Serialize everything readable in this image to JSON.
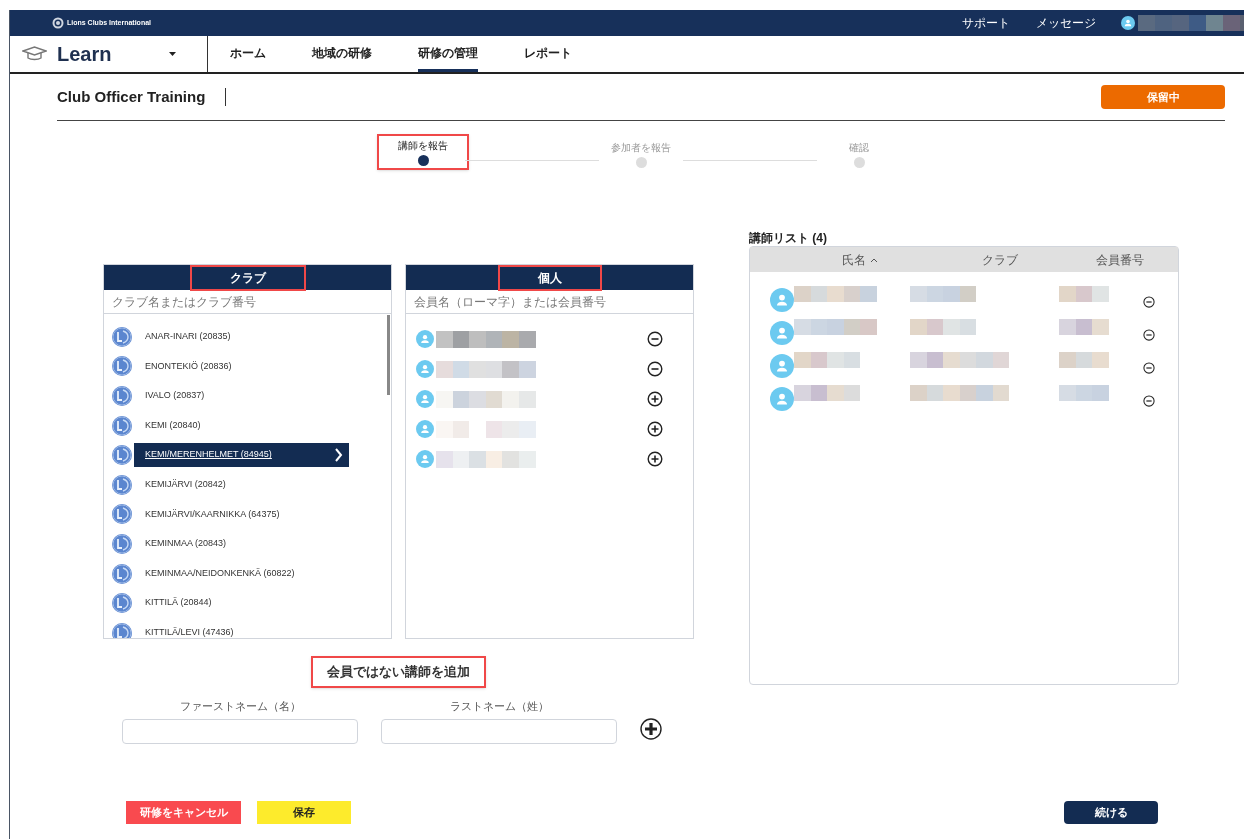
{
  "top_bar": {
    "brand": "Lions Clubs International",
    "links": [
      "サポート",
      "メッセージ"
    ]
  },
  "nav": {
    "app": "Learn",
    "tabs": [
      {
        "label": "ホーム",
        "selected": false
      },
      {
        "label": "地域の研修",
        "selected": false
      },
      {
        "label": "研修の管理",
        "selected": true
      },
      {
        "label": "レポート",
        "selected": false
      }
    ]
  },
  "page": {
    "title": "Club Officer Training",
    "status_button": "保留中"
  },
  "steps": [
    {
      "label": "講師を報告",
      "active": true,
      "highlighted": true
    },
    {
      "label": "参加者を報告",
      "active": false,
      "highlighted": false
    },
    {
      "label": "確認",
      "active": false,
      "highlighted": false
    }
  ],
  "clubs_panel": {
    "title": "クラブ",
    "highlighted": true,
    "placeholder": "クラブ名またはクラブ番号",
    "items": [
      {
        "label": "ANAR-INARI (20835)",
        "selected": false
      },
      {
        "label": "ENONTEKIÖ (20836)",
        "selected": false
      },
      {
        "label": "IVALO (20837)",
        "selected": false
      },
      {
        "label": "KEMI (20840)",
        "selected": false
      },
      {
        "label": "KEMI/MERENHELMET (84945)",
        "selected": true
      },
      {
        "label": "KEMIJÄRVI (20842)",
        "selected": false
      },
      {
        "label": "KEMIJÄRVI/KAARNIKKA (64375)",
        "selected": false
      },
      {
        "label": "KEMINMAA (20843)",
        "selected": false
      },
      {
        "label": "KEMINMAA/NEIDONKENKÄ (60822)",
        "selected": false
      },
      {
        "label": "KITTILÄ (20844)",
        "selected": false
      },
      {
        "label": "KITTILÄ/LEVI (47436)",
        "selected": false
      }
    ]
  },
  "members_panel": {
    "title": "個人",
    "highlighted": true,
    "placeholder": "会員名（ローマ字）または会員番号",
    "members": [
      {
        "added": true
      },
      {
        "added": true
      },
      {
        "added": false
      },
      {
        "added": false
      },
      {
        "added": false
      }
    ]
  },
  "instructors": {
    "title": "講師リスト (4)",
    "columns": [
      {
        "label": "氏名",
        "sorted_ascending": true
      },
      {
        "label": "クラブ",
        "sorted_ascending": false
      },
      {
        "label": "会員番号",
        "sorted_ascending": false
      }
    ],
    "rows": [
      {
        "removable": true
      },
      {
        "removable": true
      },
      {
        "removable": true
      },
      {
        "removable": true
      }
    ]
  },
  "non_member": {
    "title": "会員ではない講師を追加",
    "highlighted": true,
    "fields": [
      {
        "label": "ファーストネーム（名）"
      },
      {
        "label": "ラストネーム（姓）"
      }
    ]
  },
  "buttons": {
    "cancel": "研修をキャンセル",
    "save": "保存",
    "continue": "続ける"
  }
}
